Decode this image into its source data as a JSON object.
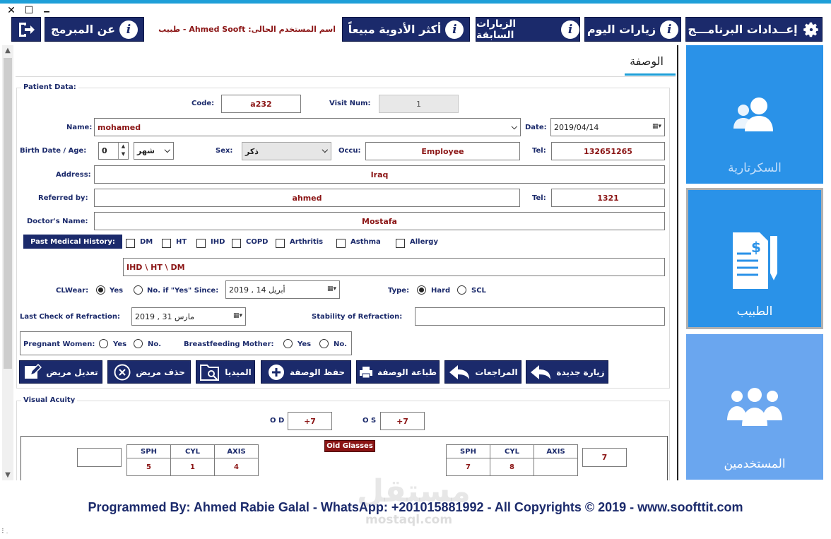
{
  "window": {
    "close": "✕",
    "maximize": "☐",
    "minimize": "▁"
  },
  "toolbar": {
    "settings": "إعــدادات البرنامـــج",
    "today_visits": "زيارات اليوم",
    "previous_visits": "الزيارات السابقة",
    "top_drugs": "أكثر الأدوية مبيعاً",
    "current_user": "اسم المستخدم الحالى: Ahmed Sooft - طبيب",
    "about_programmer": "عن المبرمج"
  },
  "tab": {
    "title": "الوصفة"
  },
  "patient": {
    "group_label": "Patient Data:",
    "code_label": "Code:",
    "code": "a232",
    "visit_label": "Visit Num:",
    "visit_num": "1",
    "name_label": "Name:",
    "name": "mohamed",
    "date_label": "Date:",
    "date": "2019/04/14",
    "birth_label": "Birth Date / Age:",
    "age": "0",
    "age_unit": "شهر",
    "sex_label": "Sex:",
    "sex": "ذكر",
    "occu_label": "Occu:",
    "occu": "Employee",
    "tel_label": "Tel:",
    "tel": "132651265",
    "address_label": "Address:",
    "address": "Iraq",
    "referred_label": "Referred by:",
    "referred": "ahmed",
    "tel2_label": "Tel:",
    "tel2": "1321",
    "doctor_label": "Doctor's Name:",
    "doctor": "Mostafa",
    "pmh_label": "Past Medical History:",
    "pmh_items": [
      "DM",
      "HT",
      "IHD",
      "COPD",
      "Arthritis",
      "Asthma",
      "Allergy"
    ],
    "pmh_text": "IHD \\ HT \\ DM",
    "clwear_label": "CLWear:",
    "clwear_yes": "Yes",
    "clwear_no": "No. if \"Yes\" Since:",
    "cl_since": "2019 ,  أبريل   14",
    "type_label": "Type:",
    "type_hard": "Hard",
    "type_scl": "SCL",
    "refraction_label": "Last Check of Refraction:",
    "refraction_date": "2019 ,  مارس   31",
    "stability_label": "Stability of Refraction:",
    "stability": "",
    "pregnant_label": "Pregnant Women:",
    "pregnant_yes": "Yes",
    "pregnant_no": "No.",
    "breast_label": "Breastfeeding Mother:",
    "breast_yes": "Yes",
    "breast_no": "No."
  },
  "actions": {
    "edit": "تعديل مريض",
    "delete": "حذف مريض",
    "media": "الميديا",
    "save": "حفظ الوصفة",
    "print": "طباعة الوصفة",
    "reviews": "المراجعات",
    "new_visit": "زيارة جديدة"
  },
  "visual": {
    "group_label": "Visual Acuity",
    "od_label": "O D",
    "od": "+7",
    "os_label": "O S",
    "os": "+7",
    "old_glasses": "Old Glasses",
    "headers": [
      "SPH",
      "CYL",
      "AXIS"
    ],
    "left_vals": [
      "5",
      "1",
      "4"
    ],
    "left_box": "",
    "right_vals": [
      "7",
      "8",
      ""
    ],
    "right_box": "7"
  },
  "sidebar": {
    "secretary": "السكرتارية",
    "doctor": "الطبيب",
    "users": "المستخدمين"
  },
  "footer": "Programmed By: Ahmed Rabie Galal - WhatsApp: +201015881992 - All Copyrights © 2019 - www.soofttit.com",
  "watermark": {
    "arabic": "مستقل",
    "latin": "mostaql.com"
  },
  "colors": {
    "navy": "#1b2a6b",
    "accent": "#1e9fd8",
    "side_blue": "#2a92e8",
    "value_red": "#8b1515"
  }
}
